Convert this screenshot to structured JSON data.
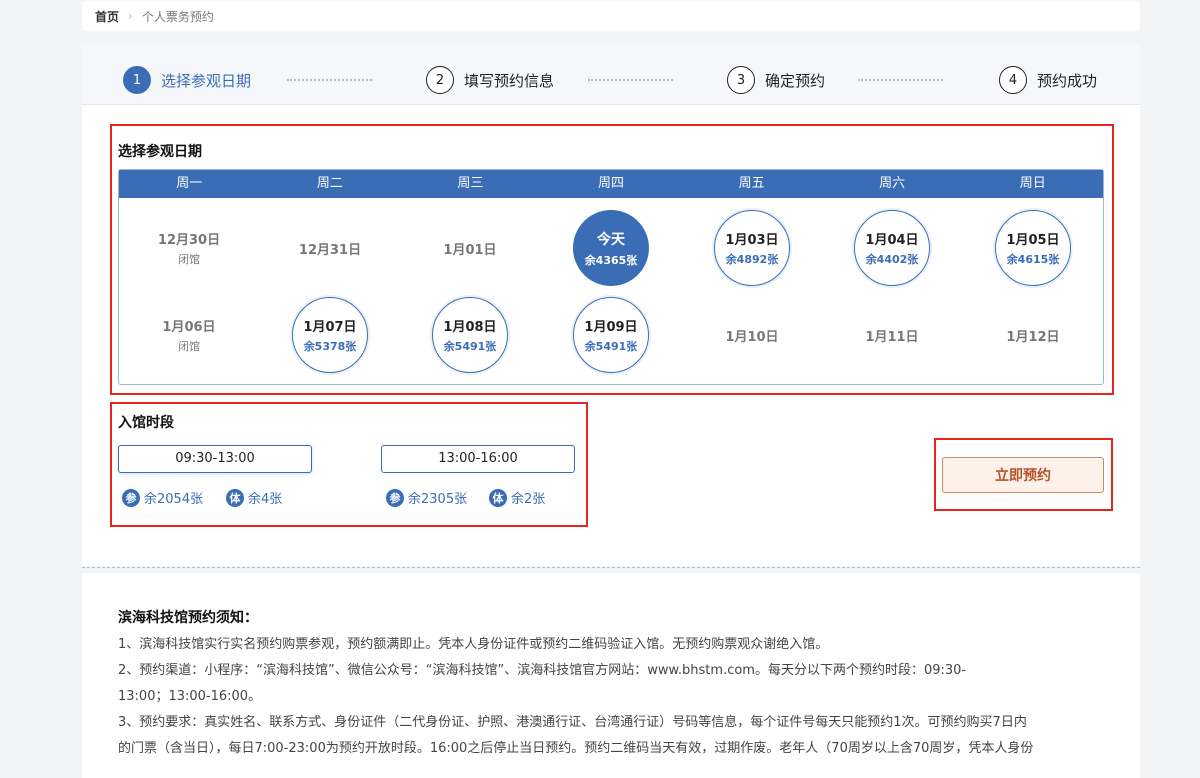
{
  "breadcrumb": {
    "home": "首页",
    "sep": "›",
    "current": "个人票务预约"
  },
  "steps": [
    {
      "num": "1",
      "label": "选择参观日期"
    },
    {
      "num": "2",
      "label": "填写预约信息"
    },
    {
      "num": "3",
      "label": "确定预约"
    },
    {
      "num": "4",
      "label": "预约成功"
    }
  ],
  "calendar": {
    "title": "选择参观日期",
    "weekdays": [
      "周一",
      "周二",
      "周三",
      "周四",
      "周五",
      "周六",
      "周日"
    ],
    "week1": [
      {
        "date": "12月30日",
        "sub": "闭馆"
      },
      {
        "date": "12月31日",
        "sub": ""
      },
      {
        "date": "1月01日",
        "sub": ""
      },
      {
        "date": "今天",
        "sub": "余4365张"
      },
      {
        "date": "1月03日",
        "sub": "余4892张"
      },
      {
        "date": "1月04日",
        "sub": "余4402张"
      },
      {
        "date": "1月05日",
        "sub": "余4615张"
      }
    ],
    "week2": [
      {
        "date": "1月06日",
        "sub": "闭馆"
      },
      {
        "date": "1月07日",
        "sub": "余5378张"
      },
      {
        "date": "1月08日",
        "sub": "余5491张"
      },
      {
        "date": "1月09日",
        "sub": "余5491张"
      },
      {
        "date": "1月10日",
        "sub": ""
      },
      {
        "date": "1月11日",
        "sub": ""
      },
      {
        "date": "1月12日",
        "sub": ""
      }
    ]
  },
  "timeslots": {
    "title": "入馆时段",
    "slots": [
      {
        "time": "09:30-13:00",
        "visit_icon": "参",
        "visit_left": "余2054张",
        "exp_icon": "体",
        "exp_left": "余4张"
      },
      {
        "time": "13:00-16:00",
        "visit_icon": "参",
        "visit_left": "余2305张",
        "exp_icon": "体",
        "exp_left": "余2张"
      }
    ]
  },
  "book_button": "立即预约",
  "notice": {
    "title": "滨海科技馆预约须知：",
    "p1": "1、滨海科技馆实行实名预约购票参观，预约额满即止。凭本人身份证件或预约二维码验证入馆。无预约购票观众谢绝入馆。",
    "p2a": "2、预约渠道：小程序：“滨海科技馆”、微信公众号：“滨海科技馆”、滨海科技馆官方网站：www.bhstm.com。每天分以下两个预约时段：09:30-",
    "p2b": "13:00；13:00-16:00。",
    "p3a": "3、预约要求：真实姓名、联系方式、身份证件（二代身份证、护照、港澳通行证、台湾通行证）号码等信息，每个证件号每天只能预约1次。可预约购买7日内",
    "p3b": "的门票（含当日），每日7:00-23:00为预约开放时段。16:00之后停止当日预约。预约二维码当天有效，过期作废。老年人（70周岁以上含70周岁，凭本人身份"
  },
  "colors": {
    "primary": "#3a6db5",
    "highlight_box": "#e8241c",
    "book_text": "#b4522a"
  }
}
